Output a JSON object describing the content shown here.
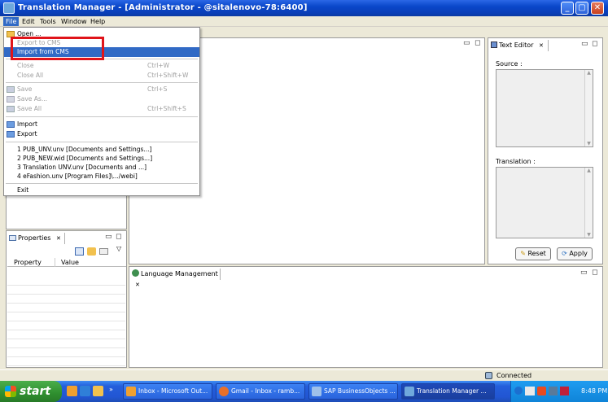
{
  "window": {
    "title": "Translation Manager - [Administrator - @sitalenovo-78:6400]"
  },
  "menubar": {
    "items": [
      "File",
      "Edit",
      "Tools",
      "Window",
      "Help"
    ]
  },
  "file_menu": {
    "open": "Open ...",
    "export_to_cms": "Export to CMS",
    "import_from_cms": "Import from CMS",
    "close": "Close",
    "close_acc": "Ctrl+W",
    "close_all": "Close All",
    "close_all_acc": "Ctrl+Shift+W",
    "save": "Save",
    "save_acc": "Ctrl+S",
    "save_as": "Save As...",
    "save_all": "Save All",
    "save_all_acc": "Ctrl+Shift+S",
    "import": "Import",
    "export": "Export",
    "recent": [
      "1 PUB_UNV.unv  [Documents and Settings...]",
      "2 PUB_NEW.wid  [Documents and Settings...]",
      "3 Translation UNV.unv  [Documents and ...]",
      "4 eFashion.unv  [Program Files]\\.../webi]"
    ],
    "exit": "Exit"
  },
  "properties_view": {
    "tab": "Properties",
    "col_property": "Property",
    "col_value": "Value"
  },
  "text_editor": {
    "tab": "Text Editor",
    "source_label": "Source :",
    "translation_label": "Translation :",
    "reset_label": "Reset",
    "apply_label": "Apply"
  },
  "language_management": {
    "tab": "Language Management"
  },
  "statusbar": {
    "status": "Connected"
  },
  "taskbar": {
    "start_label": "start",
    "items": [
      "Inbox - Microsoft Out...",
      "Gmail - Inbox - ramb...",
      "SAP BusinessObjects ...",
      "Translation Manager ..."
    ],
    "clock": "8:48 PM"
  }
}
